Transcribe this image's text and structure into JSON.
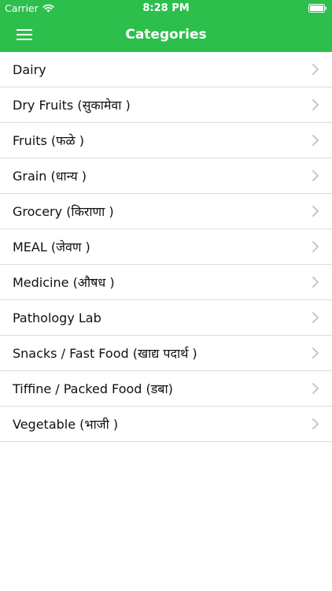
{
  "status_bar": {
    "carrier": "Carrier",
    "time": "8:28 PM",
    "wifi_icon": "wifi-icon",
    "battery_icon": "battery-full-icon"
  },
  "nav": {
    "title": "Categories",
    "menu_icon": "hamburger-menu-icon"
  },
  "colors": {
    "accent": "#2dbf4c",
    "separator": "#dcdcdc",
    "chevron": "#c7c7cc"
  },
  "categories": [
    {
      "label": "Dairy"
    },
    {
      "label": "Dry Fruits (सुकामेवा )"
    },
    {
      "label": "Fruits (फळे )"
    },
    {
      "label": "Grain (धान्य )"
    },
    {
      "label": "Grocery (किराणा )"
    },
    {
      "label": "MEAL (जेवण )"
    },
    {
      "label": "Medicine (औषध )"
    },
    {
      "label": "Pathology Lab"
    },
    {
      "label": "Snacks / Fast Food (खाद्य पदार्थ )"
    },
    {
      "label": "Tiffine / Packed Food (डबा)"
    },
    {
      "label": "Vegetable (भाजी )"
    }
  ]
}
